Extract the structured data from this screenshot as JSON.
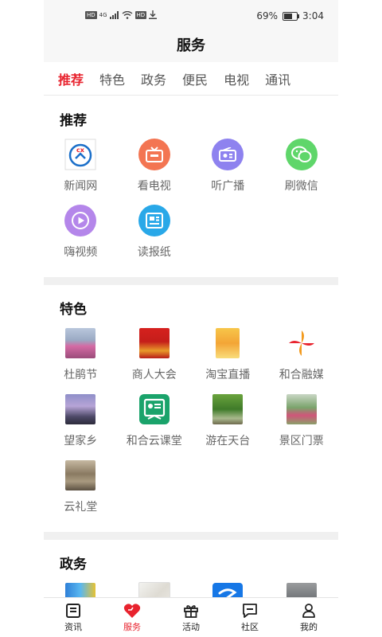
{
  "status_bar": {
    "left_chip_1": "HD",
    "left_chip_2": "HD",
    "net_label": "4G",
    "battery_text": "69%",
    "battery_level": 0.69,
    "time": "3:04"
  },
  "header": {
    "title": "服务"
  },
  "tabs": [
    {
      "label": "推荐",
      "active": true
    },
    {
      "label": "特色"
    },
    {
      "label": "政务"
    },
    {
      "label": "便民"
    },
    {
      "label": "电视"
    },
    {
      "label": "通讯"
    }
  ],
  "sections": {
    "recommend": {
      "title": "推荐",
      "items": [
        {
          "label": "新闻网",
          "icon": "news-web-icon",
          "color": "#1b6fc9"
        },
        {
          "label": "看电视",
          "icon": "tv-icon",
          "color": "#f37552"
        },
        {
          "label": "听广播",
          "icon": "radio-icon",
          "color": "#8e82ef"
        },
        {
          "label": "刷微信",
          "icon": "wechat-icon",
          "color": "#5fd66a"
        },
        {
          "label": "嗨视频",
          "icon": "video-play-icon",
          "color": "#b486ea"
        },
        {
          "label": "读报纸",
          "icon": "newspaper-icon",
          "color": "#29a8e8"
        }
      ]
    },
    "featured": {
      "title": "特色",
      "items": [
        {
          "label": "杜鹃节",
          "icon": "azalea-photo"
        },
        {
          "label": "商人大会",
          "icon": "merchant-meeting-photo"
        },
        {
          "label": "淘宝直播",
          "icon": "taobao-live-photo"
        },
        {
          "label": "和合融媒",
          "icon": "hehe-media-logo"
        },
        {
          "label": "望家乡",
          "icon": "hometown-photo"
        },
        {
          "label": "和合云课堂",
          "icon": "cloud-classroom-icon"
        },
        {
          "label": "游在天台",
          "icon": "tiantai-travel-photo"
        },
        {
          "label": "景区门票",
          "icon": "scenic-ticket-photo"
        },
        {
          "label": "云礼堂",
          "icon": "cloud-hall-photo"
        }
      ]
    },
    "government": {
      "title": "政务",
      "items": [
        {
          "icon": "gov-service-logo"
        },
        {
          "icon": "map-document-photo"
        },
        {
          "icon": "zhe-app-logo"
        },
        {
          "icon": "traffic-road-photo"
        }
      ]
    }
  },
  "bottom_nav": [
    {
      "label": "资讯",
      "icon": "news-icon"
    },
    {
      "label": "服务",
      "icon": "heart-service-icon",
      "active": true
    },
    {
      "label": "活动",
      "icon": "gift-icon"
    },
    {
      "label": "社区",
      "icon": "chat-icon"
    },
    {
      "label": "我的",
      "icon": "user-icon"
    }
  ]
}
